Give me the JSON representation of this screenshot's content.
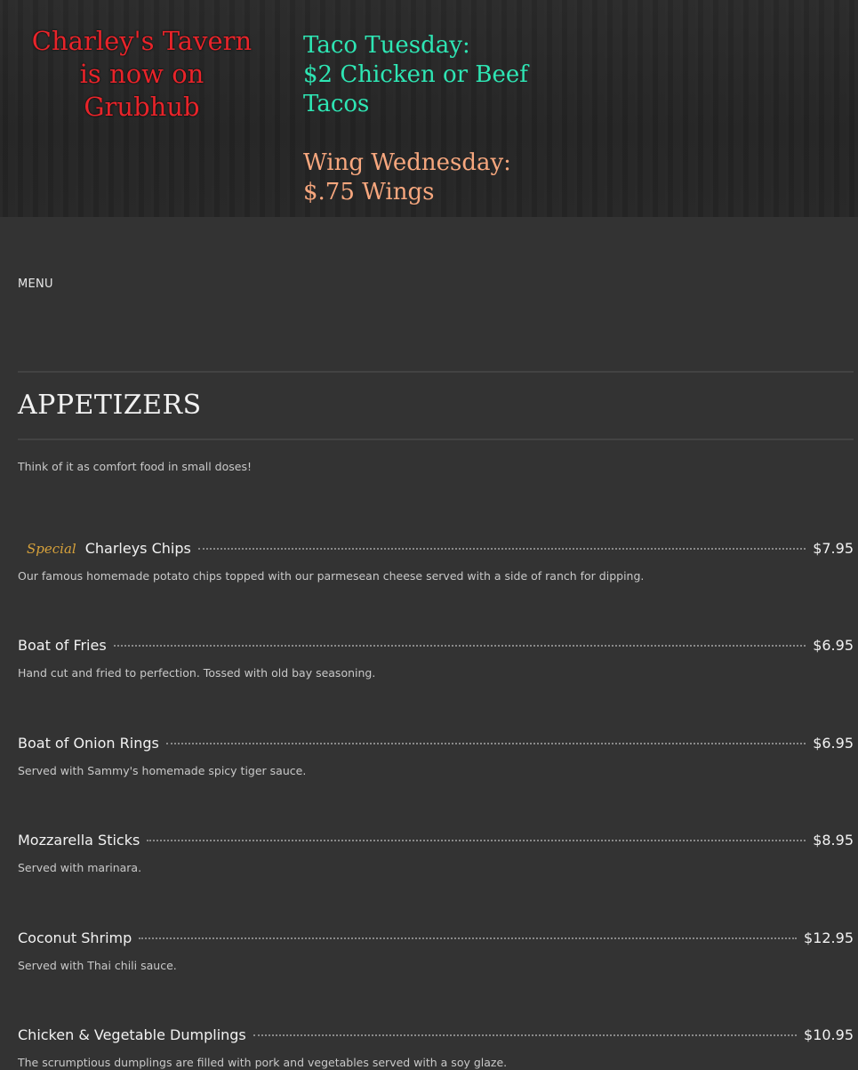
{
  "banner": {
    "grubhub_text": "Charley's Tavern is now on Grubhub",
    "taco_line1": "Taco Tuesday:",
    "taco_line2": "$2 Chicken or Beef Tacos",
    "wing_line1": "Wing Wednesday:",
    "wing_line2": "$.75 Wings",
    "colors": {
      "grubhub": "#e8242a",
      "taco": "#2ee6b4",
      "wing": "#f7a77e"
    }
  },
  "nav": {
    "menu_label": "MENU"
  },
  "section": {
    "title": "APPETIZERS",
    "description": "Think of it as comfort food in small doses!"
  },
  "items": [
    {
      "special": "Special",
      "name": "Charleys Chips",
      "price": "$7.95",
      "description": "Our famous homemade potato chips topped with our parmesean cheese served with a side of ranch for dipping."
    },
    {
      "name": "Boat of Fries",
      "price": "$6.95",
      "description": "Hand cut and fried to perfection. Tossed with old bay seasoning."
    },
    {
      "name": "Boat of Onion Rings",
      "price": "$6.95",
      "description": "Served with Sammy's homemade spicy tiger sauce."
    },
    {
      "name": "Mozzarella Sticks",
      "price": "$8.95",
      "description": "Served with marinara."
    },
    {
      "name": "Coconut Shrimp",
      "price": "$12.95",
      "description": "Served with Thai chili sauce."
    },
    {
      "name": "Chicken & Vegetable Dumplings",
      "price": "$10.95",
      "description": "The scrumptious dumplings are filled with pork and vegetables served with a soy glaze."
    }
  ]
}
